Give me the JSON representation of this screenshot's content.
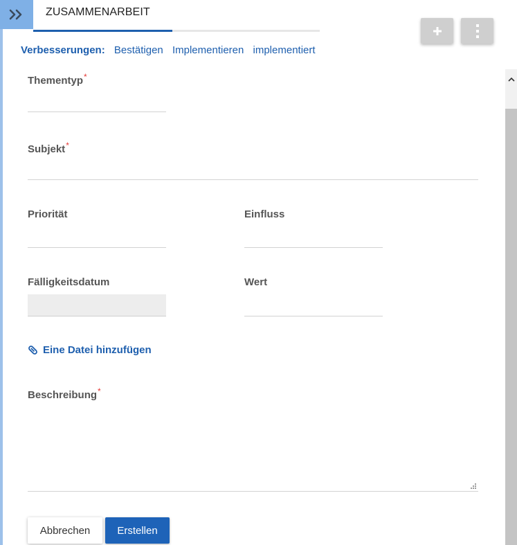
{
  "header": {
    "tab_title": "ZUSAMMENARBEIT",
    "expand_icon": "double-chevron-right-icon",
    "add_icon": "plus-icon",
    "more_icon": "vertical-dots-icon"
  },
  "improvements": {
    "label": "Verbesserungen:",
    "links": [
      "Bestätigen",
      "Implementieren",
      "implementiert"
    ]
  },
  "form": {
    "themetype_label": "Thementyp",
    "subject_label": "Subjekt",
    "priority_label": "Priorität",
    "impact_label": "Einfluss",
    "due_date_label": "Fälligkeitsdatum",
    "value_label": "Wert",
    "attach_label": "Eine Datei hinzufügen",
    "attach_icon": "paperclip-icon",
    "description_label": "Beschreibung",
    "required_marker": "*"
  },
  "actions": {
    "cancel_label": "Abbrechen",
    "create_label": "Erstellen"
  },
  "colors": {
    "accent": "#1e5fae",
    "primary_button": "#1e63b8",
    "expand_button": "#7fb0e6",
    "required": "#e53935"
  }
}
